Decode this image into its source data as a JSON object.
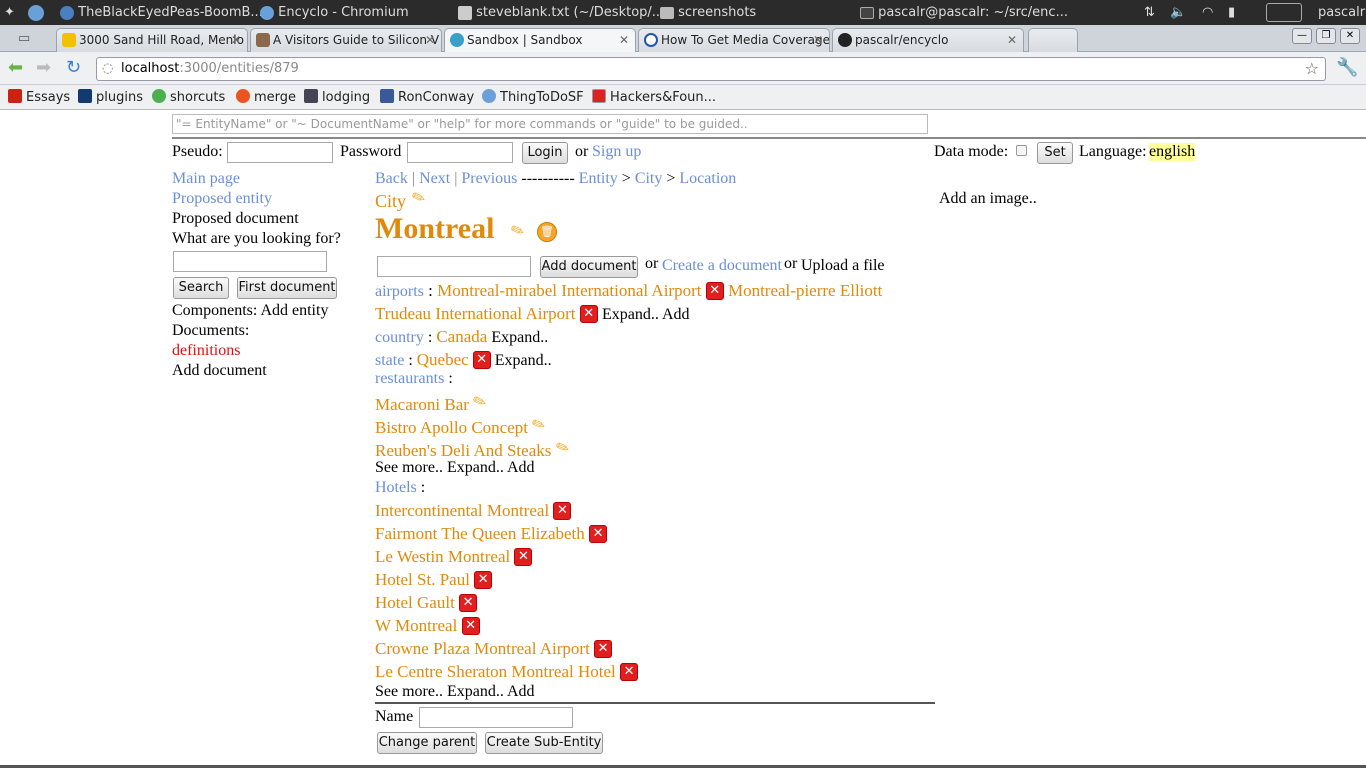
{
  "os_panel": {
    "windows": [
      "TheBlackEyedPeas-BoomB...",
      "Encyclo - Chromium",
      "steveblank.txt (~/Desktop/...",
      "screenshots",
      "pascalr@pascalr: ~/src/enc..."
    ],
    "user": "pascalr"
  },
  "tabs": [
    {
      "label": "3000 Sand Hill Road, Menlo",
      "icon": "maps-icon"
    },
    {
      "label": "A Visitors Guide to Silicon V",
      "icon": "page-icon"
    },
    {
      "label": "Sandbox | Sandbox",
      "icon": "globe-icon"
    },
    {
      "label": "How To Get Media Coverage",
      "icon": "power-icon"
    },
    {
      "label": "pascalr/encyclo",
      "icon": "github-icon"
    }
  ],
  "address": {
    "host": "localhost",
    "path": ":3000/entities/879"
  },
  "bookmarks": [
    "Essays",
    "plugins",
    "shorcuts",
    "merge",
    "lodging",
    "RonConway",
    "ThingToDoSF",
    "Hackers&Foun..."
  ],
  "command": {
    "placeholder": "\"= EntityName\" or \"~ DocumentName\" or \"help\" for more commands or \"guide\" to be guided.."
  },
  "login": {
    "pseudo_label": "Pseudo:",
    "password_label": "Password",
    "login_button": "Login",
    "or": "or",
    "signup": "Sign up",
    "data_mode_label": "Data mode:",
    "set_button": "Set",
    "language_label": "Language:",
    "language_value": "english"
  },
  "sidebar": {
    "main_page": "Main page",
    "proposed_entity": "Proposed entity",
    "proposed_document": "Proposed document",
    "looking_for": "What are you looking for?",
    "search_button": "Search",
    "first_document_button": "First document",
    "components": "Components: Add entity",
    "documents": "Documents:",
    "definitions": "definitions",
    "add_document": "Add document"
  },
  "nav": {
    "back": "Back",
    "next": "Next",
    "previous": "Previous",
    "dashes": "----------",
    "entity": "Entity",
    "city": "City",
    "location": "Location",
    "sep_pipe": "|",
    "sep_gt": ">"
  },
  "entity": {
    "type": "City",
    "name": "Montreal",
    "add_document_button": "Add document",
    "or": "or",
    "create_document": "Create a document",
    "upload_file": "Upload a file",
    "add_image": "Add an image.."
  },
  "relations": {
    "airports_label": "airports",
    "airport_1": "Montreal-mirabel International Airport",
    "airport_2a": "Montreal-pierre Elliott",
    "airport_2b": "Trudeau International Airport",
    "expand_add": "Expand.. Add",
    "country_label": "country",
    "country_value": "Canada",
    "expand": "Expand..",
    "state_label": "state",
    "state_value": "Quebec",
    "restaurants_label": "restaurants",
    "restaurants": [
      "Macaroni Bar",
      "Bistro Apollo Concept",
      "Reuben's Deli And Steaks"
    ],
    "see_more": "See more.. Expand.. Add",
    "hotels_label": "Hotels",
    "hotels": [
      "Intercontinental Montreal",
      "Fairmont The Queen Elizabeth",
      "Le Westin Montreal",
      "Hotel St. Paul",
      "Hotel Gault",
      "W Montreal",
      "Crowne Plaza Montreal Airport",
      "Le Centre Sheraton Montreal Hotel"
    ],
    "colon": ":"
  },
  "bottom_form": {
    "name_label": "Name",
    "change_parent_button": "Change parent",
    "create_sub_entity_button": "Create Sub-Entity"
  },
  "colors": {
    "link": "#6b8fd6",
    "entity": "#e08a0c",
    "delete": "#e02020",
    "language_highlight": "#ffff99"
  }
}
